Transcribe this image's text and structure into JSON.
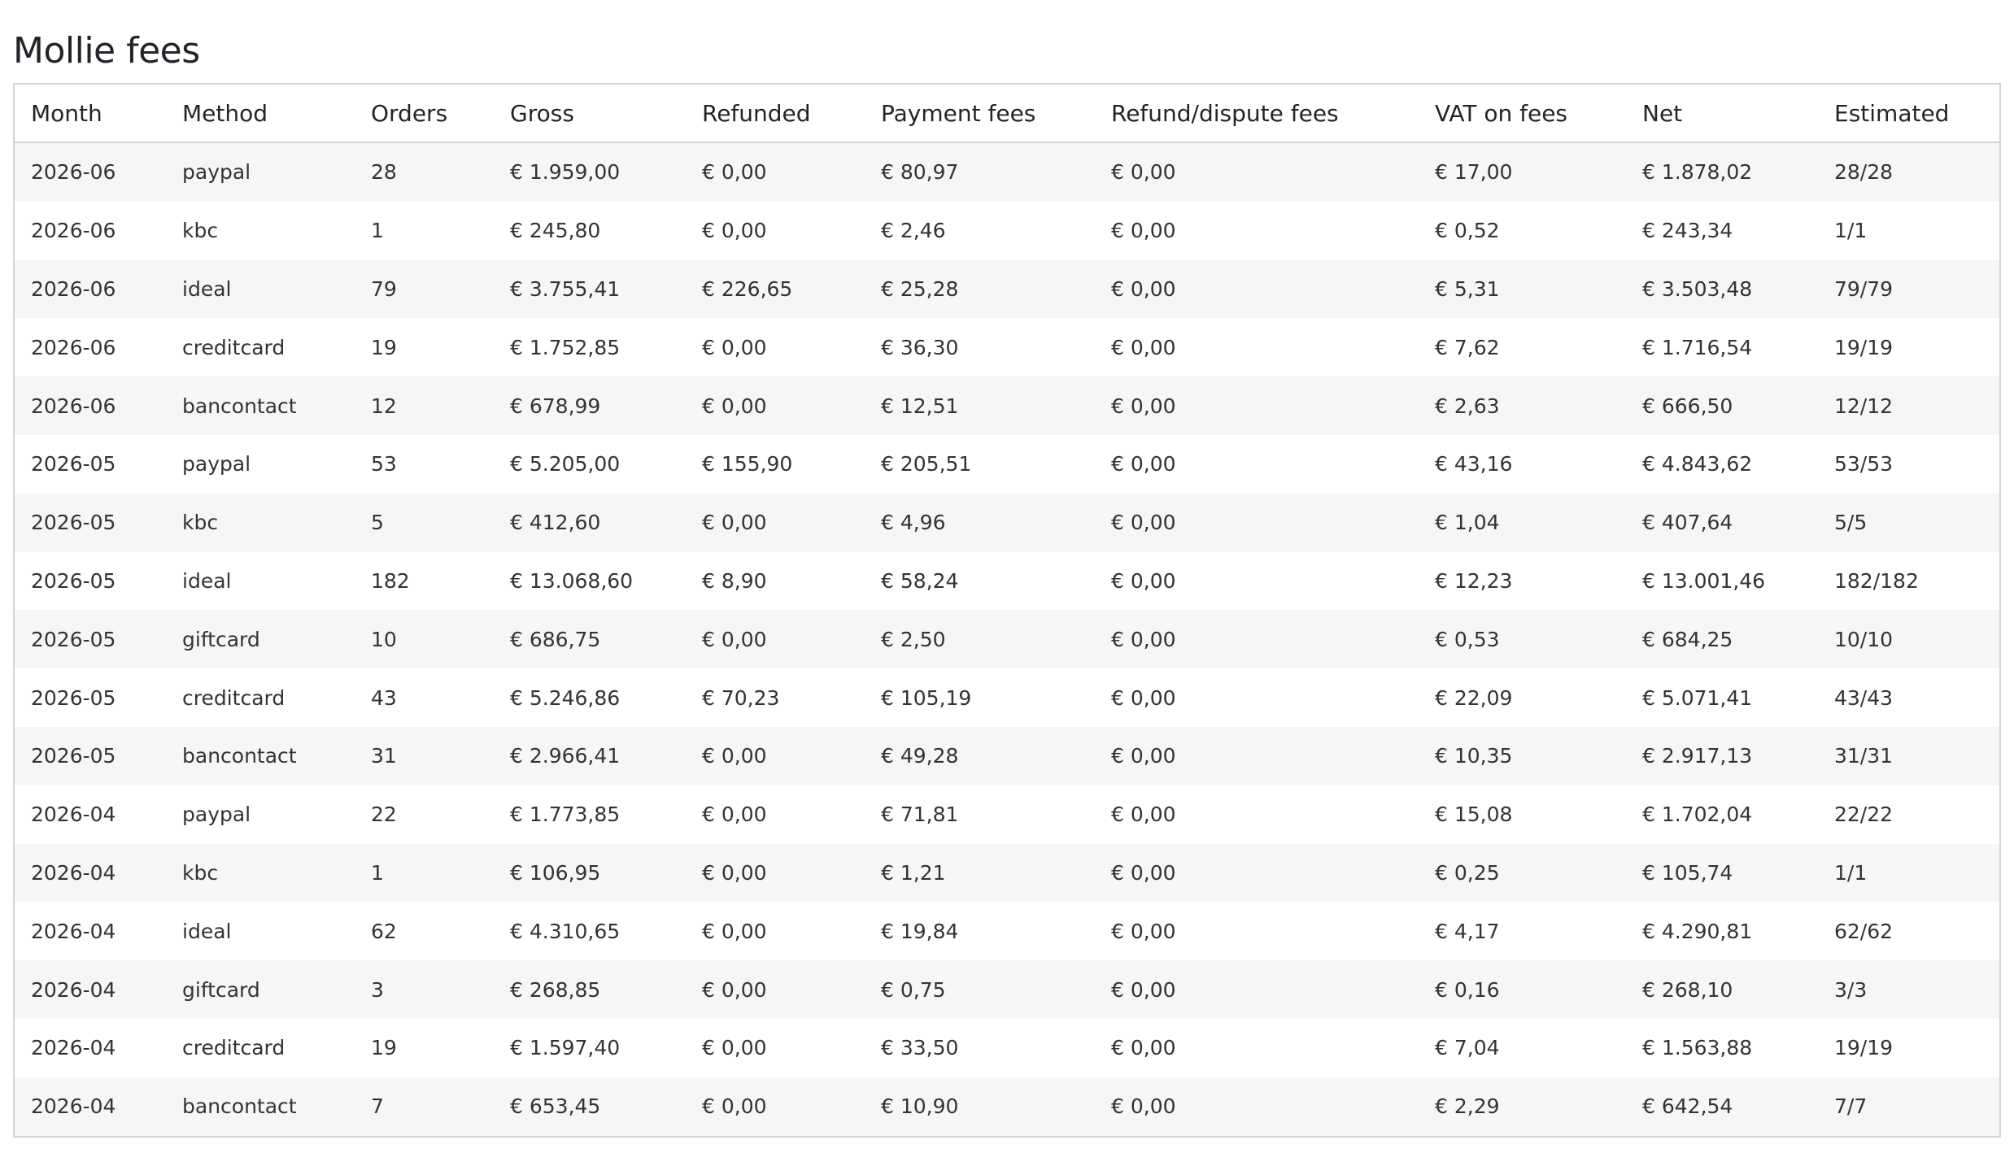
{
  "title": "Mollie fees",
  "columns": [
    "Month",
    "Method",
    "Orders",
    "Gross",
    "Refunded",
    "Payment fees",
    "Refund/dispute fees",
    "VAT on fees",
    "Net",
    "Estimated"
  ],
  "rows": [
    [
      "2026-06",
      "paypal",
      "28",
      "€ 1.959,00",
      "€ 0,00",
      "€ 80,97",
      "€ 0,00",
      "€ 17,00",
      "€ 1.878,02",
      "28/28"
    ],
    [
      "2026-06",
      "kbc",
      "1",
      "€ 245,80",
      "€ 0,00",
      "€ 2,46",
      "€ 0,00",
      "€ 0,52",
      "€ 243,34",
      "1/1"
    ],
    [
      "2026-06",
      "ideal",
      "79",
      "€ 3.755,41",
      "€ 226,65",
      "€ 25,28",
      "€ 0,00",
      "€ 5,31",
      "€ 3.503,48",
      "79/79"
    ],
    [
      "2026-06",
      "creditcard",
      "19",
      "€ 1.752,85",
      "€ 0,00",
      "€ 36,30",
      "€ 0,00",
      "€ 7,62",
      "€ 1.716,54",
      "19/19"
    ],
    [
      "2026-06",
      "bancontact",
      "12",
      "€ 678,99",
      "€ 0,00",
      "€ 12,51",
      "€ 0,00",
      "€ 2,63",
      "€ 666,50",
      "12/12"
    ],
    [
      "2026-05",
      "paypal",
      "53",
      "€ 5.205,00",
      "€ 155,90",
      "€ 205,51",
      "€ 0,00",
      "€ 43,16",
      "€ 4.843,62",
      "53/53"
    ],
    [
      "2026-05",
      "kbc",
      "5",
      "€ 412,60",
      "€ 0,00",
      "€ 4,96",
      "€ 0,00",
      "€ 1,04",
      "€ 407,64",
      "5/5"
    ],
    [
      "2026-05",
      "ideal",
      "182",
      "€ 13.068,60",
      "€ 8,90",
      "€ 58,24",
      "€ 0,00",
      "€ 12,23",
      "€ 13.001,46",
      "182/182"
    ],
    [
      "2026-05",
      "giftcard",
      "10",
      "€ 686,75",
      "€ 0,00",
      "€ 2,50",
      "€ 0,00",
      "€ 0,53",
      "€ 684,25",
      "10/10"
    ],
    [
      "2026-05",
      "creditcard",
      "43",
      "€ 5.246,86",
      "€ 70,23",
      "€ 105,19",
      "€ 0,00",
      "€ 22,09",
      "€ 5.071,41",
      "43/43"
    ],
    [
      "2026-05",
      "bancontact",
      "31",
      "€ 2.966,41",
      "€ 0,00",
      "€ 49,28",
      "€ 0,00",
      "€ 10,35",
      "€ 2.917,13",
      "31/31"
    ],
    [
      "2026-04",
      "paypal",
      "22",
      "€ 1.773,85",
      "€ 0,00",
      "€ 71,81",
      "€ 0,00",
      "€ 15,08",
      "€ 1.702,04",
      "22/22"
    ],
    [
      "2026-04",
      "kbc",
      "1",
      "€ 106,95",
      "€ 0,00",
      "€ 1,21",
      "€ 0,00",
      "€ 0,25",
      "€ 105,74",
      "1/1"
    ],
    [
      "2026-04",
      "ideal",
      "62",
      "€ 4.310,65",
      "€ 0,00",
      "€ 19,84",
      "€ 0,00",
      "€ 4,17",
      "€ 4.290,81",
      "62/62"
    ],
    [
      "2026-04",
      "giftcard",
      "3",
      "€ 268,85",
      "€ 0,00",
      "€ 0,75",
      "€ 0,00",
      "€ 0,16",
      "€ 268,10",
      "3/3"
    ],
    [
      "2026-04",
      "creditcard",
      "19",
      "€ 1.597,40",
      "€ 0,00",
      "€ 33,50",
      "€ 0,00",
      "€ 7,04",
      "€ 1.563,88",
      "19/19"
    ],
    [
      "2026-04",
      "bancontact",
      "7",
      "€ 653,45",
      "€ 0,00",
      "€ 10,90",
      "€ 0,00",
      "€ 2,29",
      "€ 642,54",
      "7/7"
    ]
  ]
}
